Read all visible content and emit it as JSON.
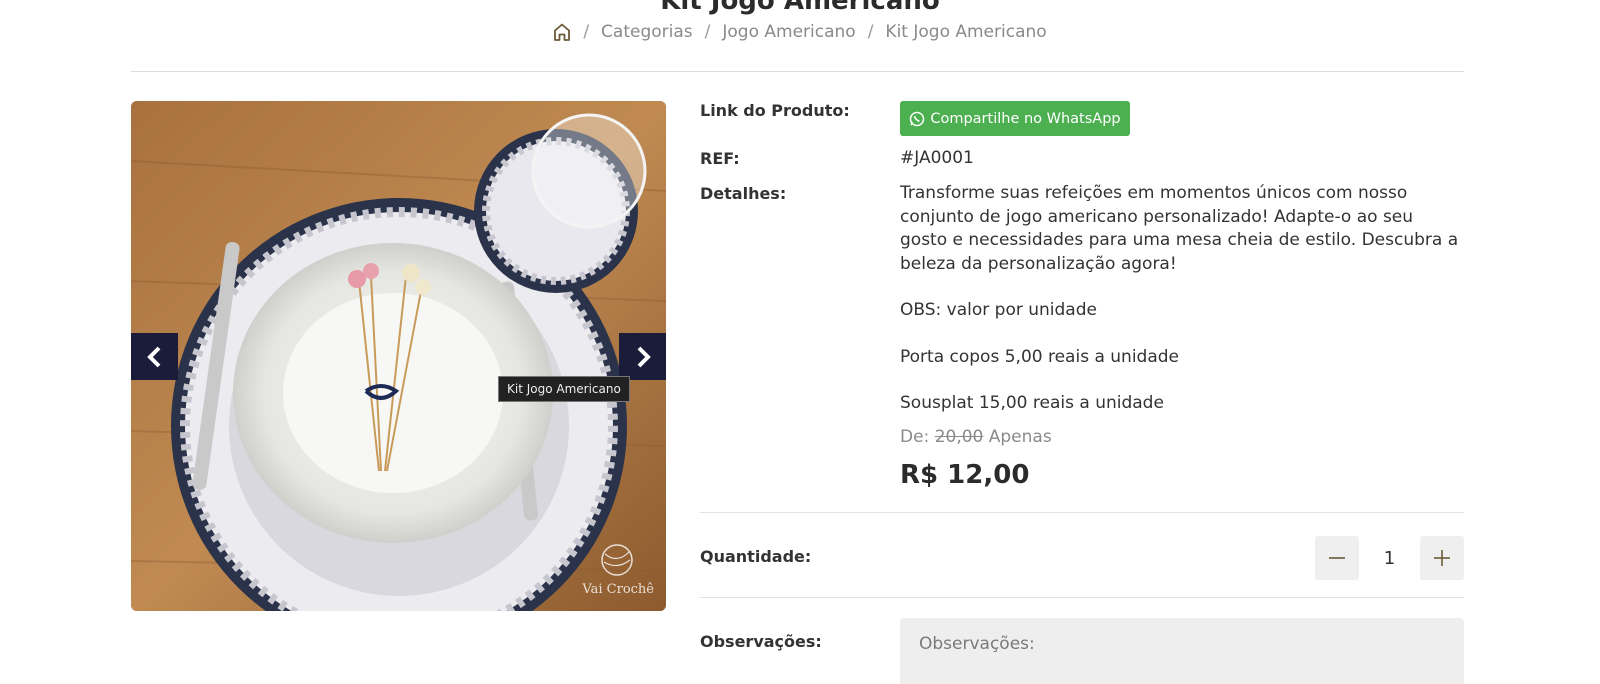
{
  "page": {
    "title": "Kit Jogo Americano"
  },
  "breadcrumb": {
    "home_icon": "home-icon",
    "items": [
      "Categorias",
      "Jogo Americano",
      "Kit Jogo Americano"
    ]
  },
  "gallery": {
    "tooltip": "Kit Jogo Americano",
    "watermark": "Vai Crochê",
    "prev_icon": "chevron-left-icon",
    "next_icon": "chevron-right-icon"
  },
  "product": {
    "link_label": "Link do Produto:",
    "share_button": "Compartilhe no WhatsApp",
    "share_icon": "whatsapp-icon",
    "share_color": "#4caf50",
    "ref_label": "REF:",
    "ref_value": "#JA0001",
    "details_label": "Detalhes:",
    "details": [
      "Transforme suas refeições em momentos únicos com nosso conjunto de jogo americano personalizado! Adapte-o ao seu gosto e necessidades para uma mesa cheia de estilo. Descubra a beleza da personalização agora!",
      "OBS: valor por unidade",
      "Porta copos 5,00 reais a unidade",
      "Sousplat 15,00 reais a unidade"
    ],
    "old_price_prefix": "De:",
    "old_price": "20,00",
    "old_price_suffix": "Apenas",
    "price": "R$ 12,00"
  },
  "quantity": {
    "label": "Quantidade:",
    "value": "1",
    "minus_icon": "minus-icon",
    "plus_icon": "plus-icon"
  },
  "notes": {
    "label": "Observações:",
    "placeholder": "Observações:"
  }
}
